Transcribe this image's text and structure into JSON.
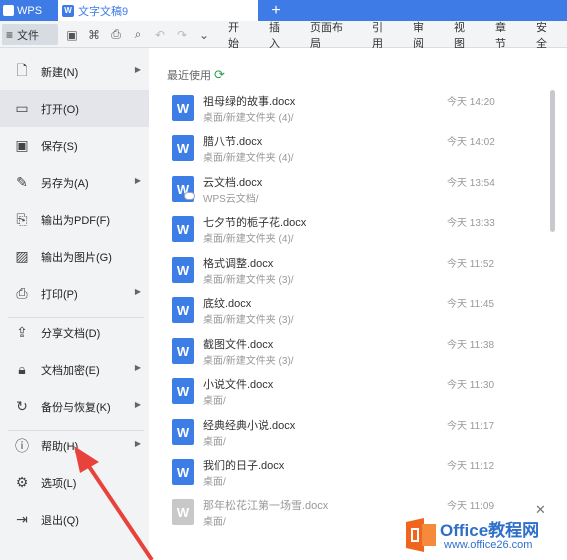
{
  "tabs": {
    "app_label": "WPS",
    "doc_label": "文字文稿9",
    "new_tab": "+"
  },
  "toolbar": {
    "file_label": "文件",
    "icons": [
      "save-icon",
      "copy-format-icon",
      "print-icon",
      "preview-icon",
      "undo-icon",
      "redo-icon",
      "more-icon"
    ],
    "menu": [
      "开始",
      "插入",
      "页面布局",
      "引用",
      "审阅",
      "视图",
      "章节",
      "安全"
    ]
  },
  "file_menu": {
    "items": [
      {
        "label": "新建(N)",
        "icon": "new-doc-icon",
        "has_arrow": true
      },
      {
        "label": "打开(O)",
        "icon": "folder-icon",
        "has_arrow": false,
        "selected": true
      },
      {
        "label": "保存(S)",
        "icon": "save-icon",
        "has_arrow": false
      },
      {
        "label": "另存为(A)",
        "icon": "save-as-icon",
        "has_arrow": true
      },
      {
        "label": "输出为PDF(F)",
        "icon": "pdf-icon",
        "has_arrow": false
      },
      {
        "label": "输出为图片(G)",
        "icon": "image-icon",
        "has_arrow": false
      },
      {
        "label": "打印(P)",
        "icon": "print-icon",
        "has_arrow": true
      },
      {
        "label": "分享文档(D)",
        "icon": "share-icon",
        "has_arrow": false
      },
      {
        "label": "文档加密(E)",
        "icon": "lock-icon",
        "has_arrow": true
      },
      {
        "label": "备份与恢复(K)",
        "icon": "backup-icon",
        "has_arrow": true
      },
      {
        "label": "帮助(H)",
        "icon": "help-icon",
        "has_arrow": true
      },
      {
        "label": "选项(L)",
        "icon": "gear-icon",
        "has_arrow": false
      },
      {
        "label": "退出(Q)",
        "icon": "exit-icon",
        "has_arrow": false
      }
    ]
  },
  "recent": {
    "title": "最近使用",
    "items": [
      {
        "name": "祖母绿的故事.docx",
        "path": "桌面/新建文件夹 (4)/",
        "time": "今天 14:20"
      },
      {
        "name": "腊八节.docx",
        "path": "桌面/新建文件夹 (4)/",
        "time": "今天 14:02"
      },
      {
        "name": "云文档.docx",
        "path": "WPS云文档/",
        "time": "今天 13:54",
        "cloud": true
      },
      {
        "name": "七夕节的栀子花.docx",
        "path": "桌面/新建文件夹 (4)/",
        "time": "今天 13:33"
      },
      {
        "name": "格式调整.docx",
        "path": "桌面/新建文件夹 (3)/",
        "time": "今天 11:52"
      },
      {
        "name": "底纹.docx",
        "path": "桌面/新建文件夹 (3)/",
        "time": "今天 11:45"
      },
      {
        "name": "截图文件.docx",
        "path": "桌面/新建文件夹 (3)/",
        "time": "今天 11:38"
      },
      {
        "name": "小说文件.docx",
        "path": "桌面/",
        "time": "今天 11:30"
      },
      {
        "name": "经典经典小说.docx",
        "path": "桌面/",
        "time": "今天 11:17"
      },
      {
        "name": "我们的日子.docx",
        "path": "桌面/",
        "time": "今天 11:12"
      },
      {
        "name": "那年松花江第一场雪.docx",
        "path": "桌面/",
        "time": "今天 11:09",
        "faded": true
      }
    ]
  },
  "brand": {
    "title": "Office教程网",
    "url": "www.office26.com",
    "close": "✕"
  },
  "colors": {
    "accent": "#3e7be6",
    "doc_icon": "#3c7ee6",
    "arrow": "#e8433a",
    "brand_orange": "#f0641e"
  }
}
